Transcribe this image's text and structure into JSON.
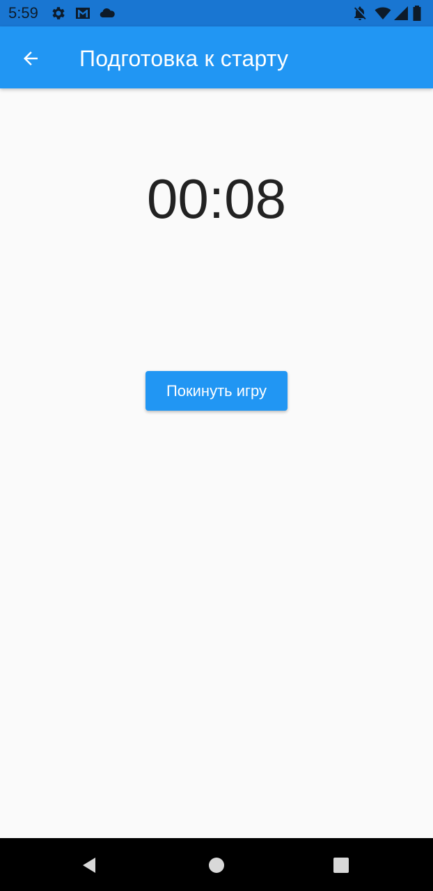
{
  "status_bar": {
    "time": "5:59",
    "icons": [
      "settings-icon",
      "gmail-icon",
      "cloud-icon",
      "notifications-off-icon",
      "wifi-icon",
      "signal-icon",
      "battery-icon"
    ]
  },
  "app_bar": {
    "title": "Подготовка к старту",
    "back_icon": "arrow-back-icon",
    "color": "#2196f3"
  },
  "main": {
    "timer": "00:08",
    "leave_button_label": "Покинуть игру"
  },
  "nav_bar": {
    "buttons": [
      "back-triangle-icon",
      "home-circle-icon",
      "recents-square-icon"
    ]
  },
  "colors": {
    "status_bar": "#1976d2",
    "primary": "#2196f3",
    "background": "#fafafa",
    "timer_text": "#222222"
  }
}
